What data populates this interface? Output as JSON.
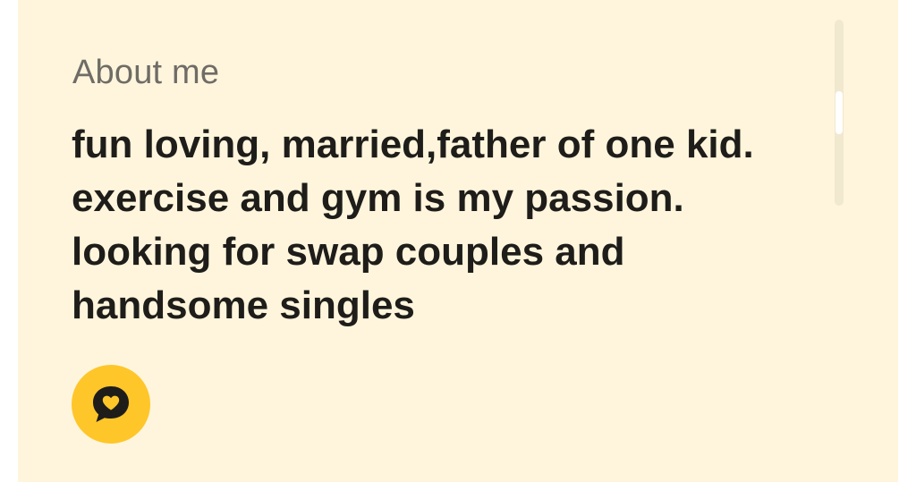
{
  "about": {
    "heading": "About me",
    "bio_lines": [
      "fun loving, married,father of one kid.",
      "exercise and gym is my passion.",
      "looking for swap couples and",
      "handsome singles"
    ]
  },
  "compliment": {
    "icon": "heart-chat-bubble-icon",
    "bg_color": "#ffc629"
  },
  "colors": {
    "background": "#fef5dc",
    "heading": "#6f6c66",
    "text": "#1e1d1a"
  }
}
